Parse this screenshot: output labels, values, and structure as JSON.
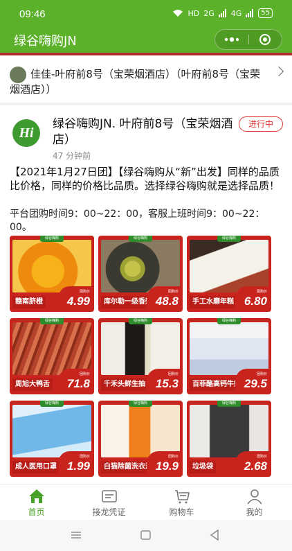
{
  "status_bar": {
    "time": "09:46",
    "network": "HD",
    "signal1": "2G",
    "signal2": "4G",
    "battery": "55"
  },
  "title_bar": {
    "title": "绿谷嗨购JN",
    "more_icon": "more-dots-icon",
    "close_icon": "target-close-icon"
  },
  "store": {
    "name": "佳佳-叶府前8号（宝荣烟酒店）（叶府前8号（宝荣烟酒店））",
    "chevron": "chevron-right-icon"
  },
  "post": {
    "logo_text": "Hi",
    "title": "绿谷嗨购JN. 叶府前8号（宝荣烟酒店）",
    "status": "进行中",
    "time": "47 分钟前",
    "body": "【2021年1月27日团】【绿谷嗨购从“新”出发】同样的品质比价格，同样的价格比品质。选择绿谷嗨购就是选择品质！",
    "note": "平台团购时间9：00~22：00，客服上班时间9：00~22：00。",
    "promo_label": "团购价",
    "tag_label": "绿谷嗨购",
    "products": [
      {
        "name": "赣南脐橙",
        "price": "4.99"
      },
      {
        "name": "库尔勒一级香梨",
        "price": "48.8"
      },
      {
        "name": "手工水磨年糕",
        "price": "6.80"
      },
      {
        "name": "周旭大鸭舌",
        "price": "71.8"
      },
      {
        "name": "千禾头鲜生抽",
        "price": "15.3"
      },
      {
        "name": "百菲酪高钙牛奶",
        "price": "29.5"
      },
      {
        "name": "成人医用口罩",
        "price": "1.99"
      },
      {
        "name": "白猫除菌洗衣液",
        "price": "19.9"
      },
      {
        "name": "垃圾袋",
        "price": "2.68"
      }
    ]
  },
  "tabs": [
    {
      "label": "首页",
      "icon": "home-icon",
      "active": true
    },
    {
      "label": "接龙凭证",
      "icon": "voucher-icon",
      "active": false
    },
    {
      "label": "购物车",
      "icon": "cart-icon",
      "active": false
    },
    {
      "label": "我的",
      "icon": "user-icon",
      "active": false
    }
  ],
  "colors": {
    "brand_green": "#5bb12a",
    "accent_red": "#c8241d",
    "active_tab": "#4aa12a"
  }
}
